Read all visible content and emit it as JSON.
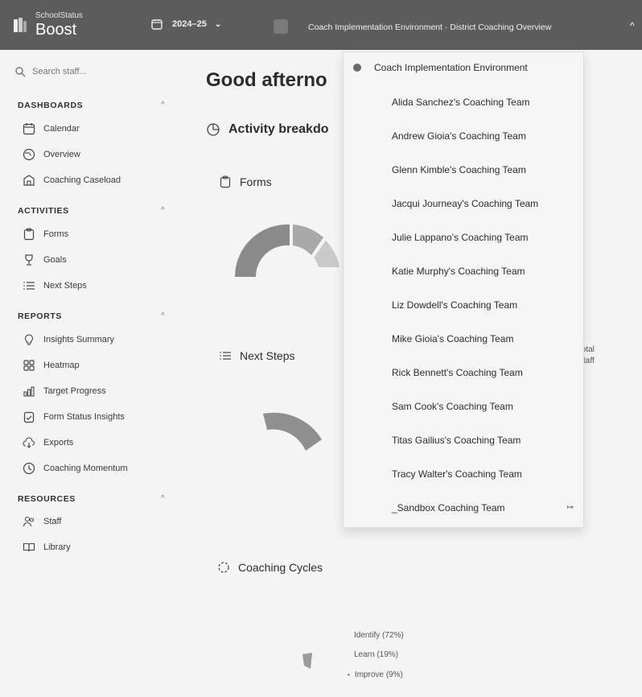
{
  "header": {
    "brand_small": "SchoolStatus",
    "brand_big": "Boost",
    "year": "2024–25",
    "environment": "Coach Implementation Environment · District Coaching Overview"
  },
  "sidebar": {
    "search_placeholder": "Search staff...",
    "sections": {
      "dashboards": "DASHBOARDS",
      "activities": "ACTIVITIES",
      "reports": "REPORTS",
      "resources": "RESOURCES"
    },
    "items": {
      "calendar": "Calendar",
      "overview": "Overview",
      "coaching_caseload": "Coaching Caseload",
      "forms": "Forms",
      "goals": "Goals",
      "next_steps": "Next Steps",
      "insights_summary": "Insights Summary",
      "heatmap": "Heatmap",
      "target_progress": "Target Progress",
      "form_status_insights": "Form Status Insights",
      "exports": "Exports",
      "coaching_momentum": "Coaching Momentum",
      "staff": "Staff",
      "library": "Library"
    }
  },
  "main": {
    "greeting": "Good afterno",
    "activity_breakdown": "Activity breakdo",
    "forms": "Forms",
    "next_steps": "Next Steps",
    "coaching_cycles": "Coaching Cycles",
    "total_label": "total",
    "staff_label": "staff",
    "legend": [
      "Identify (72%)",
      "Learn (19%)",
      "Improve (9%)"
    ]
  },
  "dropdown": {
    "header": "Coach Implementation Environment",
    "items": [
      "Alida Sanchez's Coaching Team",
      "Andrew Gioia's Coaching Team",
      "Glenn Kimble's Coaching Team",
      "Jacqui Journeay's Coaching Team",
      "Julie Lappano's Coaching Team",
      "Katie Murphy's Coaching Team",
      "Liz Dowdell's Coaching Team",
      "Mike Gioia's Coaching Team",
      "Rick Bennett's Coaching Team",
      "Sam Cook's Coaching Team",
      "Titas Gailius's Coaching Team",
      "Tracy Walter's Coaching Team",
      "_Sandbox Coaching Team"
    ],
    "side_icon": "↦"
  },
  "colors": {
    "topbar": "#5c5c5c",
    "background": "#f4f4f4",
    "dropdown_bg": "#f5f5f5"
  },
  "icons": {
    "search": "search-icon",
    "calendar": "calendar-icon",
    "overview": "globe-icon",
    "caseload": "building-icon",
    "forms": "clipboard-icon",
    "goals": "trophy-icon",
    "next_steps": "list-icon",
    "insights": "lightbulb-icon",
    "heatmap": "grid-icon",
    "target": "bar-chart-icon",
    "form_status": "clipboard-check-icon",
    "exports": "cloud-download-icon",
    "momentum": "clock-icon",
    "staff": "users-icon",
    "library": "book-icon"
  }
}
